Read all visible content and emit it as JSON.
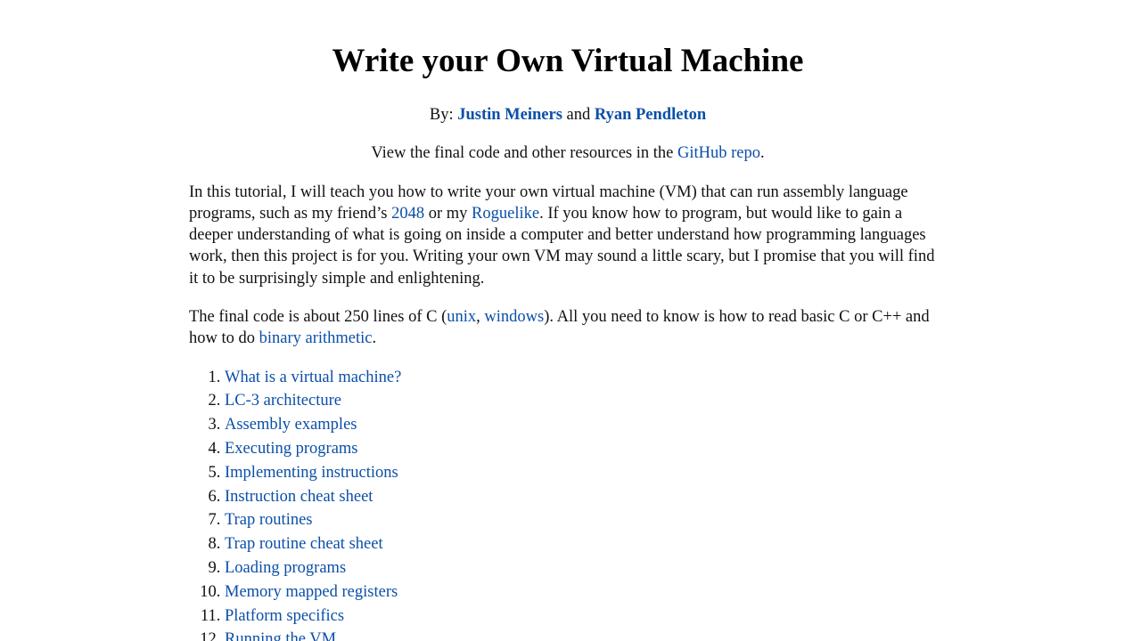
{
  "title": "Write your Own Virtual Machine",
  "byline": {
    "prefix": "By: ",
    "author1": "Justin Meiners",
    "conjunction": " and ",
    "author2": "Ryan Pendleton"
  },
  "resources": {
    "before": "View the final code and other resources in the ",
    "link": "GitHub repo",
    "after": "."
  },
  "intro": {
    "t1": "In this tutorial, I will teach you how to write your own virtual machine (VM) that can run assembly language programs, such as my friend’s ",
    "link1": "2048",
    "t2": " or my ",
    "link2": "Roguelike",
    "t3": ". If you know how to program, but would like to gain a deeper understanding of what is going on inside a computer and better understand how programming languages work, then this project is for you. Writing your own VM may sound a little scary, but I promise that you will find it to be surprisingly simple and enlightening."
  },
  "code_info": {
    "t1": "The final code is about 250 lines of C (",
    "link1": "unix",
    "sep": ", ",
    "link2": "windows",
    "t2": "). All you need to know is how to read basic C or C++ and how to do ",
    "link3": "binary arithmetic",
    "t3": "."
  },
  "toc": [
    "What is a virtual machine?",
    "LC-3 architecture",
    "Assembly examples",
    "Executing programs",
    "Implementing instructions",
    "Instruction cheat sheet",
    "Trap routines",
    "Trap routine cheat sheet",
    "Loading programs",
    "Memory mapped registers",
    "Platform specifics",
    "Running the VM"
  ],
  "colors": {
    "link": "#0b4fa8",
    "text": "#111111"
  }
}
